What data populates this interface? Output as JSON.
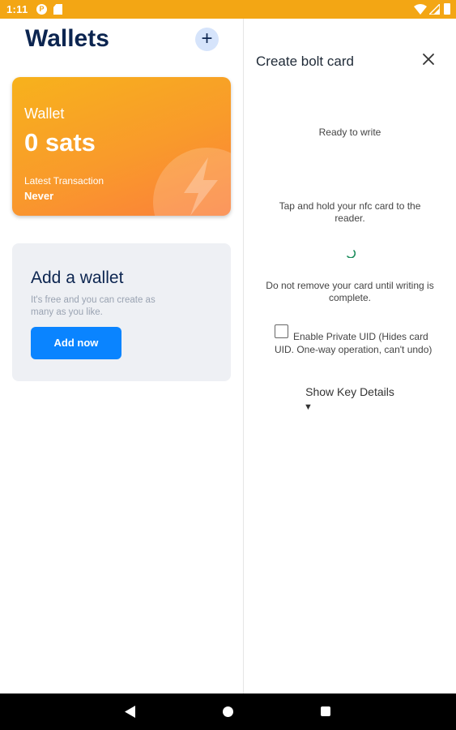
{
  "status_bar": {
    "time": "1:11",
    "icons": [
      "p-notification-icon",
      "sd-card-icon",
      "wifi-icon",
      "signal-icon",
      "battery-icon"
    ],
    "background": "#f3a614"
  },
  "wallets_panel": {
    "title": "Wallets",
    "add_icon": "plus-icon",
    "wallet_card": {
      "name": "Wallet",
      "balance": "0 sats",
      "latest_label": "Latest Transaction",
      "latest_value": "Never",
      "icon": "lightning-bolt-icon",
      "gradient": [
        "#f7b21c",
        "#fb7f3b"
      ]
    },
    "add_wallet": {
      "title": "Add a wallet",
      "subtitle": "It's free and you can create as many as you like.",
      "button_label": "Add now",
      "button_color": "#0a84ff"
    }
  },
  "bolt_card_panel": {
    "title": "Create bolt card",
    "close_icon": "close-icon",
    "status": "Ready to write",
    "instruction": "Tap and hold your nfc card to the reader.",
    "spinner_icon": "loading-spinner-icon",
    "warning": "Do not remove your card until writing is complete.",
    "private_uid": {
      "label": "Enable Private UID (Hides card UID. One-way operation, can't undo)",
      "checked": false
    },
    "show_key_details": "Show Key Details",
    "expand_icon": "triangle-down-icon"
  },
  "nav_bar": {
    "buttons": [
      "back-icon",
      "home-icon",
      "recents-icon"
    ]
  }
}
